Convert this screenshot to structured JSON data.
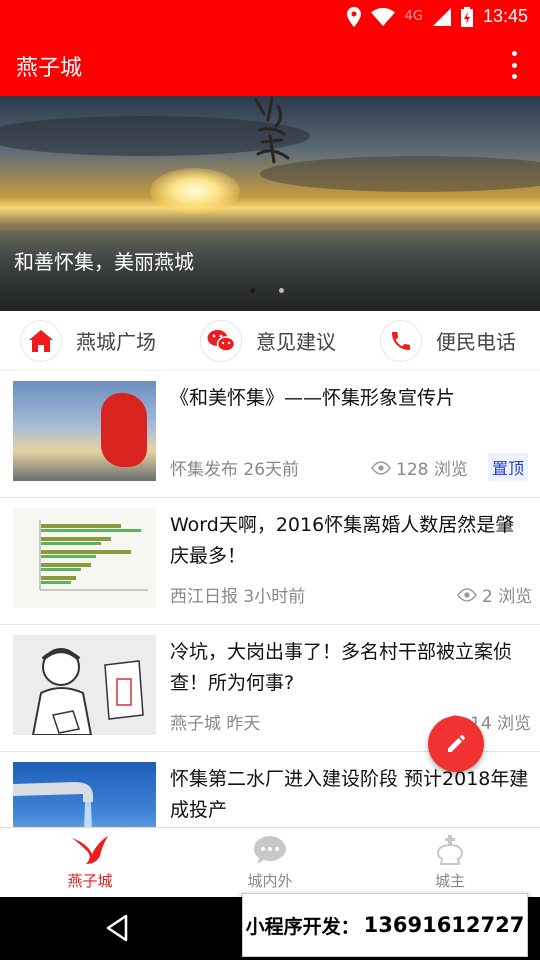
{
  "status_bar": {
    "time": "13:45",
    "network": "4G"
  },
  "app_bar": {
    "title": "燕子城"
  },
  "banner": {
    "caption": "和善怀集，美丽燕城",
    "slide_count": 2,
    "active_slide": 1
  },
  "quick_links": [
    {
      "label": "燕城广场",
      "icon": "home-icon"
    },
    {
      "label": "意见建议",
      "icon": "wechat-icon"
    },
    {
      "label": "便民电话",
      "icon": "phone-icon"
    }
  ],
  "news": [
    {
      "title": "《和美怀集》——怀集形象宣传片",
      "source": "怀集发布 26天前",
      "views": "128 浏览",
      "badge": "置顶"
    },
    {
      "title": "Word天啊，2016怀集离婚人数居然是肇庆最多！",
      "source": "西江日报 3小时前",
      "views": "2 浏览"
    },
    {
      "title": "冷坑，大岗出事了！多名村干部被立案侦查！所为何事?",
      "source": "燕子城 昨天",
      "views": "14 浏览"
    },
    {
      "title": "怀集第二水厂进入建设阶段 预计2018年建成投产",
      "source": "",
      "views": ""
    }
  ],
  "bottom_nav": [
    {
      "label": "燕子城",
      "active": true
    },
    {
      "label": "城内外",
      "active": false
    },
    {
      "label": "城主",
      "active": false
    }
  ],
  "ad_overlay": {
    "label": "小程序开发：",
    "phone": "13691612727"
  },
  "colors": {
    "primary": "#ff0000",
    "inactive": "#bbbbbb",
    "badge_text": "#1d3fd0",
    "fab": "#f03232"
  }
}
